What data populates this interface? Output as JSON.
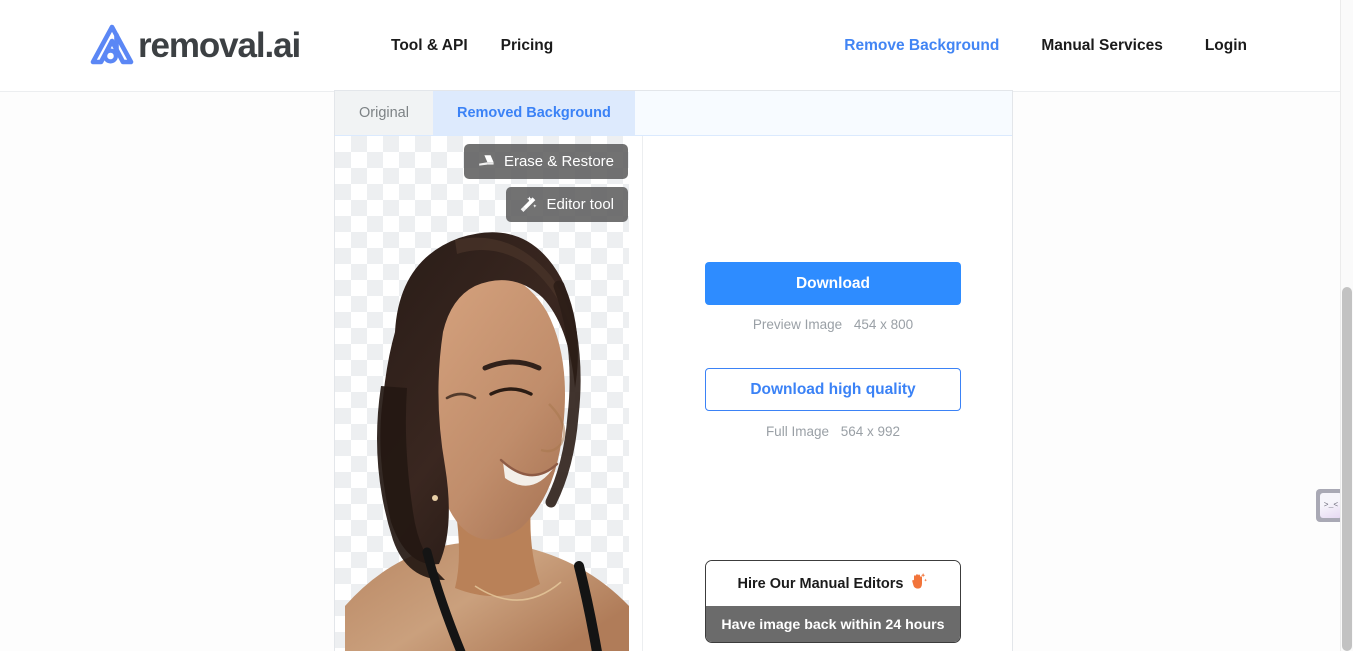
{
  "header": {
    "brand_name": "removal.ai",
    "logo_icon": "removal-ai-logo-icon",
    "nav_left": [
      {
        "label": "Tool & API"
      },
      {
        "label": "Pricing"
      }
    ],
    "nav_right": [
      {
        "label": "Remove Background",
        "accent": true
      },
      {
        "label": "Manual Services",
        "accent": false
      },
      {
        "label": "Login",
        "accent": false
      }
    ],
    "accent_color": "#4285f4"
  },
  "editor": {
    "tabs": [
      {
        "label": "Original",
        "active": false
      },
      {
        "label": "Removed Background",
        "active": true
      }
    ],
    "image_actions": [
      {
        "label": "Erase & Restore",
        "icon": "eraser-icon"
      },
      {
        "label": "Editor tool",
        "icon": "magic-wand-icon"
      }
    ],
    "canvas": {
      "type": "transparent-checkerboard",
      "subject": "portrait-photo-woman"
    }
  },
  "downloads": {
    "primary_button": "Download",
    "primary_meta_label": "Preview Image",
    "primary_meta_size": "454 x 800",
    "secondary_button": "Download high quality",
    "secondary_meta_label": "Full Image",
    "secondary_meta_size": "564 x 992",
    "primary_color": "#2e8cff",
    "secondary_color": "#3b82f6"
  },
  "promo": {
    "title": "Hire Our Manual Editors",
    "title_icon": "raised-hand-sparkle-icon",
    "subtitle": "Have image back within 24 hours",
    "subtitle_bg": "#6b6b6b"
  },
  "widget": {
    "face": ">_<",
    "name": "feedback-widget"
  }
}
